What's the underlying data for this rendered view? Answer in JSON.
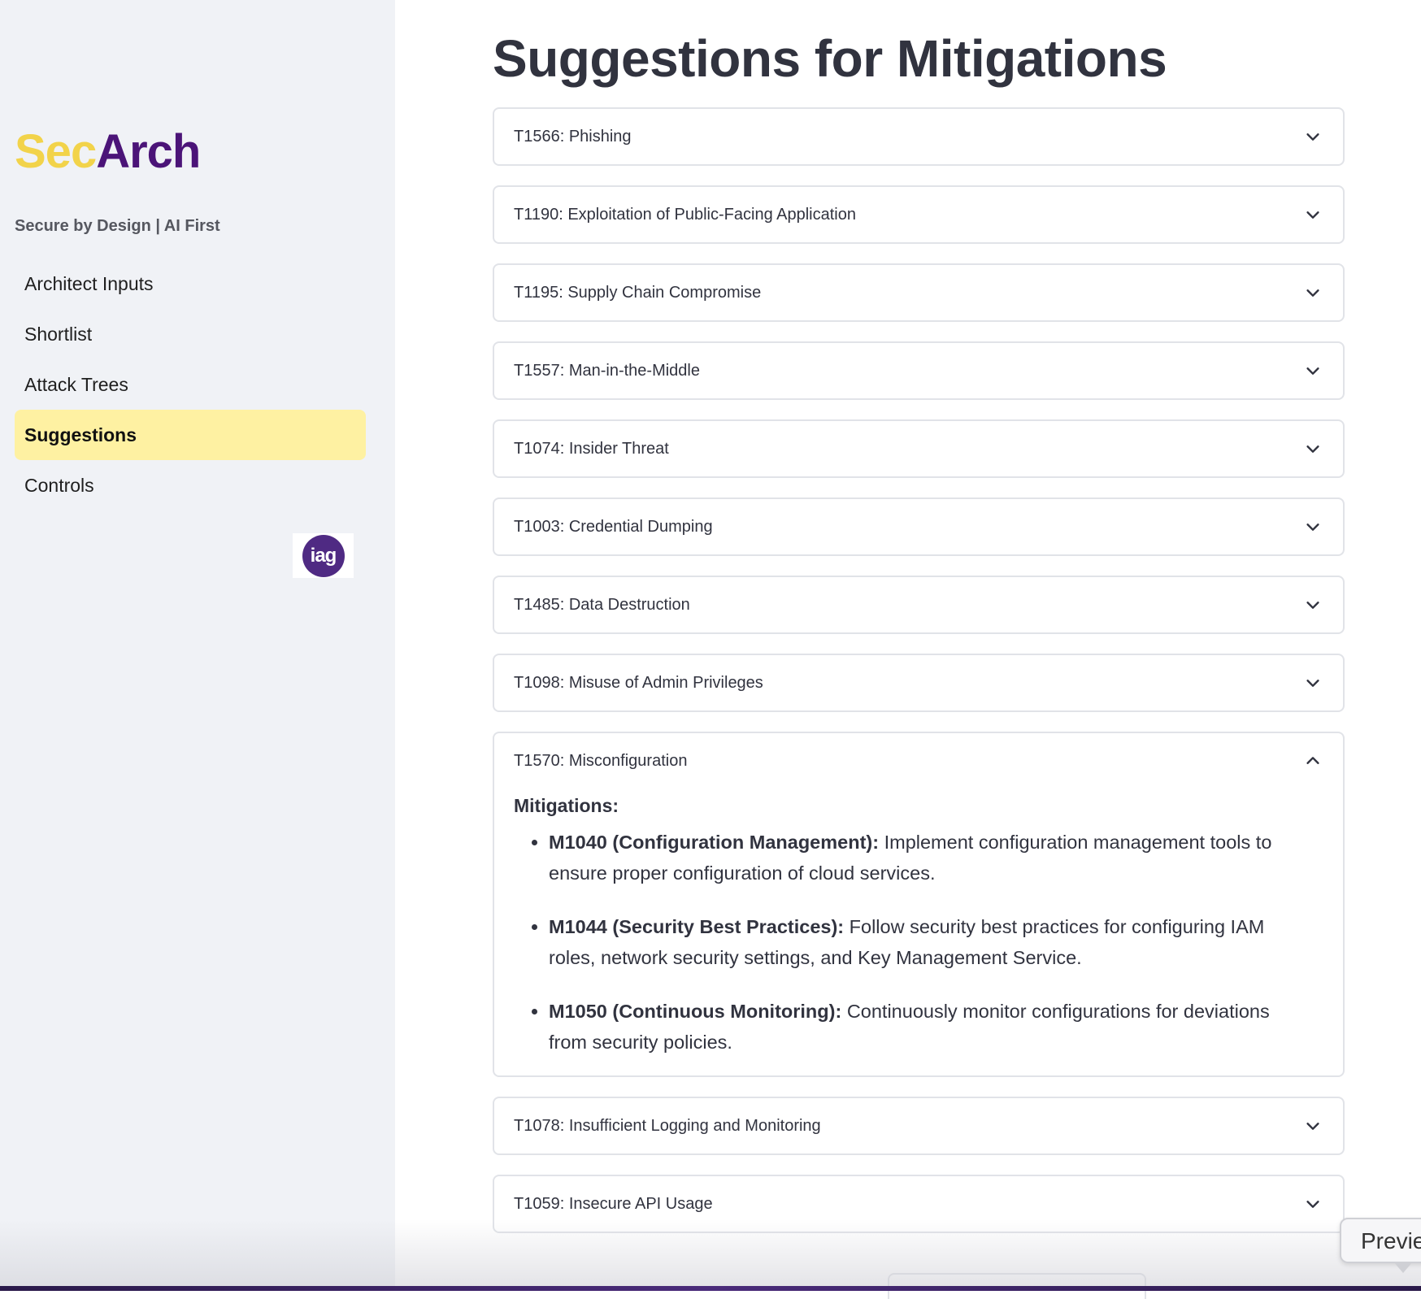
{
  "app": {
    "logo_part1": "Sec",
    "logo_part2": "Arch",
    "tagline": "Secure by Design | AI First",
    "badge_text": "iag",
    "colors": {
      "logo_sec": "#f2d34a",
      "logo_arch": "#4b1478",
      "active_nav": "#fef1a2",
      "badge": "#4f2a83"
    }
  },
  "sidebar": {
    "items": [
      {
        "label": "Architect Inputs",
        "active": false
      },
      {
        "label": "Shortlist",
        "active": false
      },
      {
        "label": "Attack Trees",
        "active": false
      },
      {
        "label": "Suggestions",
        "active": true
      },
      {
        "label": "Controls",
        "active": false
      }
    ]
  },
  "main": {
    "title": "Suggestions for Mitigations",
    "expanders": [
      {
        "label": "T1566: Phishing",
        "expanded": false
      },
      {
        "label": "T1190: Exploitation of Public-Facing Application",
        "expanded": false
      },
      {
        "label": "T1195: Supply Chain Compromise",
        "expanded": false
      },
      {
        "label": "T1557: Man-in-the-Middle",
        "expanded": false
      },
      {
        "label": "T1074: Insider Threat",
        "expanded": false
      },
      {
        "label": "T1003: Credential Dumping",
        "expanded": false
      },
      {
        "label": "T1485: Data Destruction",
        "expanded": false
      },
      {
        "label": "T1098: Misuse of Admin Privileges",
        "expanded": false
      },
      {
        "label": "T1570: Misconfiguration",
        "expanded": true,
        "mitigations_heading": "Mitigations:",
        "mitigations": [
          {
            "code": "M1040 (Configuration Management):",
            "text": " Implement configuration management tools to ensure proper configuration of cloud services."
          },
          {
            "code": "M1044 (Security Best Practices):",
            "text": " Follow security best practices for configuring IAM roles, network security settings, and Key Management Service."
          },
          {
            "code": "M1050 (Continuous Monitoring):",
            "text": " Continuously monitor configurations for deviations from security policies."
          }
        ]
      },
      {
        "label": "T1078: Insufficient Logging and Monitoring",
        "expanded": false
      },
      {
        "label": "T1059: Insecure API Usage",
        "expanded": false
      }
    ]
  },
  "overlay": {
    "preview_label": "Previe"
  }
}
